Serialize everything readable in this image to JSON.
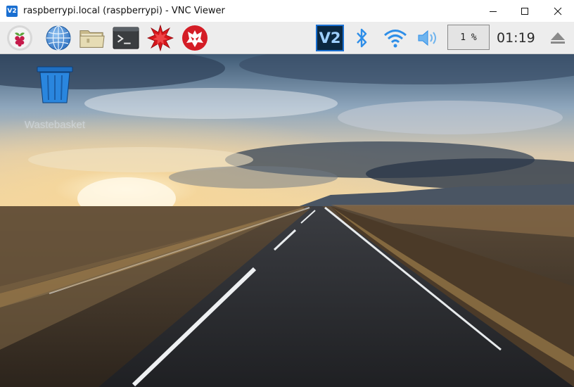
{
  "window": {
    "title": "raspberrypi.local (raspberrypi) - VNC Viewer",
    "app_icon_text": "V2"
  },
  "panel": {
    "launchers": [
      {
        "name": "raspberry-menu-icon"
      },
      {
        "name": "web-browser-icon"
      },
      {
        "name": "file-manager-icon"
      },
      {
        "name": "terminal-icon"
      },
      {
        "name": "mathematica-icon"
      },
      {
        "name": "wolfram-icon"
      }
    ],
    "tray": {
      "vnc_icon_text": "V2",
      "cpu_usage": "1 %",
      "clock": "01:19"
    }
  },
  "desktop": {
    "icons": [
      {
        "label": "Wastebasket"
      }
    ]
  },
  "colors": {
    "vnc_accent": "#1a6fd1",
    "tray_blue": "#2e8ee8",
    "panel_bg": "#ededed"
  }
}
